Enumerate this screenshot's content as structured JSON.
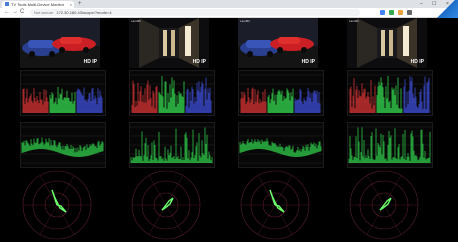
{
  "browser": {
    "tab_title": "TV Tools Multi-Device Monitor",
    "tab_close": "×",
    "new_tab": "+",
    "window_controls": [
      "–",
      "☐",
      "×"
    ],
    "nav": [
      "←",
      "→",
      "C"
    ],
    "secure_label": "Not secure",
    "url": "172.30.180.43/scope/?mode=4",
    "colors": {
      "tab_bar": "#dee1e6",
      "omnibox": "#f1f3f4"
    },
    "extensions": [
      {
        "icon": "extension-icon",
        "color": "#4285f4"
      },
      {
        "icon": "bookmark-icon",
        "color": "#34a853"
      },
      {
        "icon": "profile-icon",
        "color": "#e8a33d"
      },
      {
        "icon": "menu-icon",
        "color": "#666666"
      }
    ]
  },
  "panels": [
    {
      "video_label": "",
      "video_type": "cars",
      "badge": "HD IP"
    },
    {
      "video_label": "Landfill",
      "video_type": "hallway",
      "badge": "HD IP"
    },
    {
      "video_label": "Landfill",
      "video_type": "cars",
      "badge": "HD IP"
    },
    {
      "video_label": "Landfill",
      "video_type": "hallway",
      "badge": "HD IP"
    }
  ],
  "scopes": {
    "rgb_parade": {
      "colors": [
        "#ff3b3b",
        "#3bff5a",
        "#4a5bff"
      ]
    },
    "waveform": {
      "color": "#39ff5a"
    },
    "vectorscope": {
      "graticule_color": "#5a1f2c",
      "trace_color": "#6bff6b"
    }
  }
}
